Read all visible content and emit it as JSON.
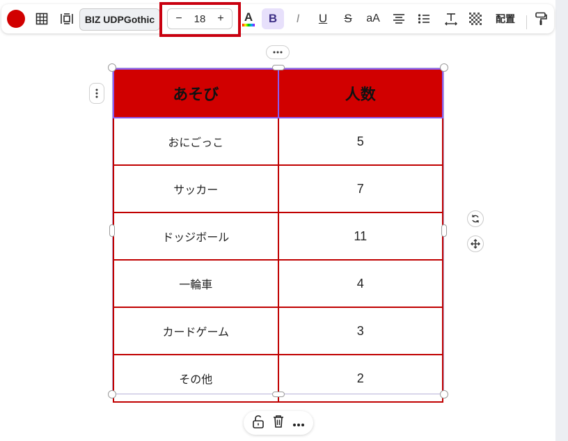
{
  "toolbar": {
    "text_color": "#d10000",
    "font_name": "BIZ UDPGothic",
    "font_size": "18",
    "decrease_label": "−",
    "increase_label": "+",
    "text_color_glyph": "A",
    "bold_label": "B",
    "italic_label": "I",
    "underline_label": "U",
    "strikethrough_label": "S",
    "case_label": "aA",
    "arrange_label": "配置"
  },
  "table": {
    "headers": [
      "あそび",
      "人数"
    ],
    "rows": [
      [
        "おにごっこ",
        "5"
      ],
      [
        "サッカー",
        "7"
      ],
      [
        "ドッジボール",
        "11"
      ],
      [
        "一輪車",
        "4"
      ],
      [
        "カードゲーム",
        "3"
      ],
      [
        "その他",
        "2"
      ]
    ],
    "header_color": "#d10000",
    "border_color": "#c00000"
  }
}
